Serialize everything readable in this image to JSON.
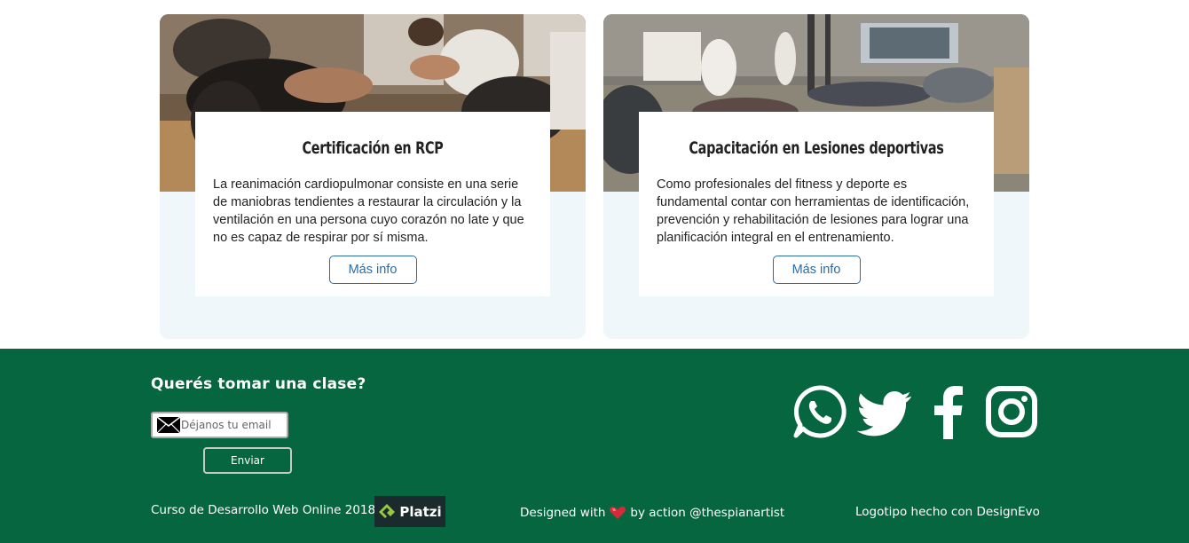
{
  "cards": [
    {
      "title": "Certificación en RCP",
      "text": "La reanimación cardiopulmonar consiste en una serie de maniobras tendientes a restaurar la circulación y la ventilación en una persona cuyo corazón no late y que no es capaz de respirar por sí misma.",
      "button_label": "Más info"
    },
    {
      "title": "Capacitación en Lesiones deportivas",
      "text": "Como profesionales del fitness y deporte es fundamental contar con herramientas de identificación, prevención y rehabilitación de lesiones para lograr una planificación integral en el entrenamiento.",
      "button_label": "Más info"
    }
  ],
  "footer": {
    "cta_title": "Querés tomar una clase?",
    "email_placeholder": "Déjanos tu email",
    "send_label": "Enviar",
    "social_icons": [
      "whatsapp-icon",
      "twitter-icon",
      "facebook-icon",
      "instagram-icon"
    ],
    "course_credit": "Curso de Desarrollo Web Online 2018",
    "platzi_label": "Platzi",
    "designed_with": "Designed with",
    "designed_by": "by action @thespianartist",
    "logo_credit": "Logotipo hecho con DesignEvo"
  },
  "colors": {
    "footer_bg": "#066640",
    "button_blue": "#2a6ca8",
    "card_bg": "#f0f7fb"
  }
}
